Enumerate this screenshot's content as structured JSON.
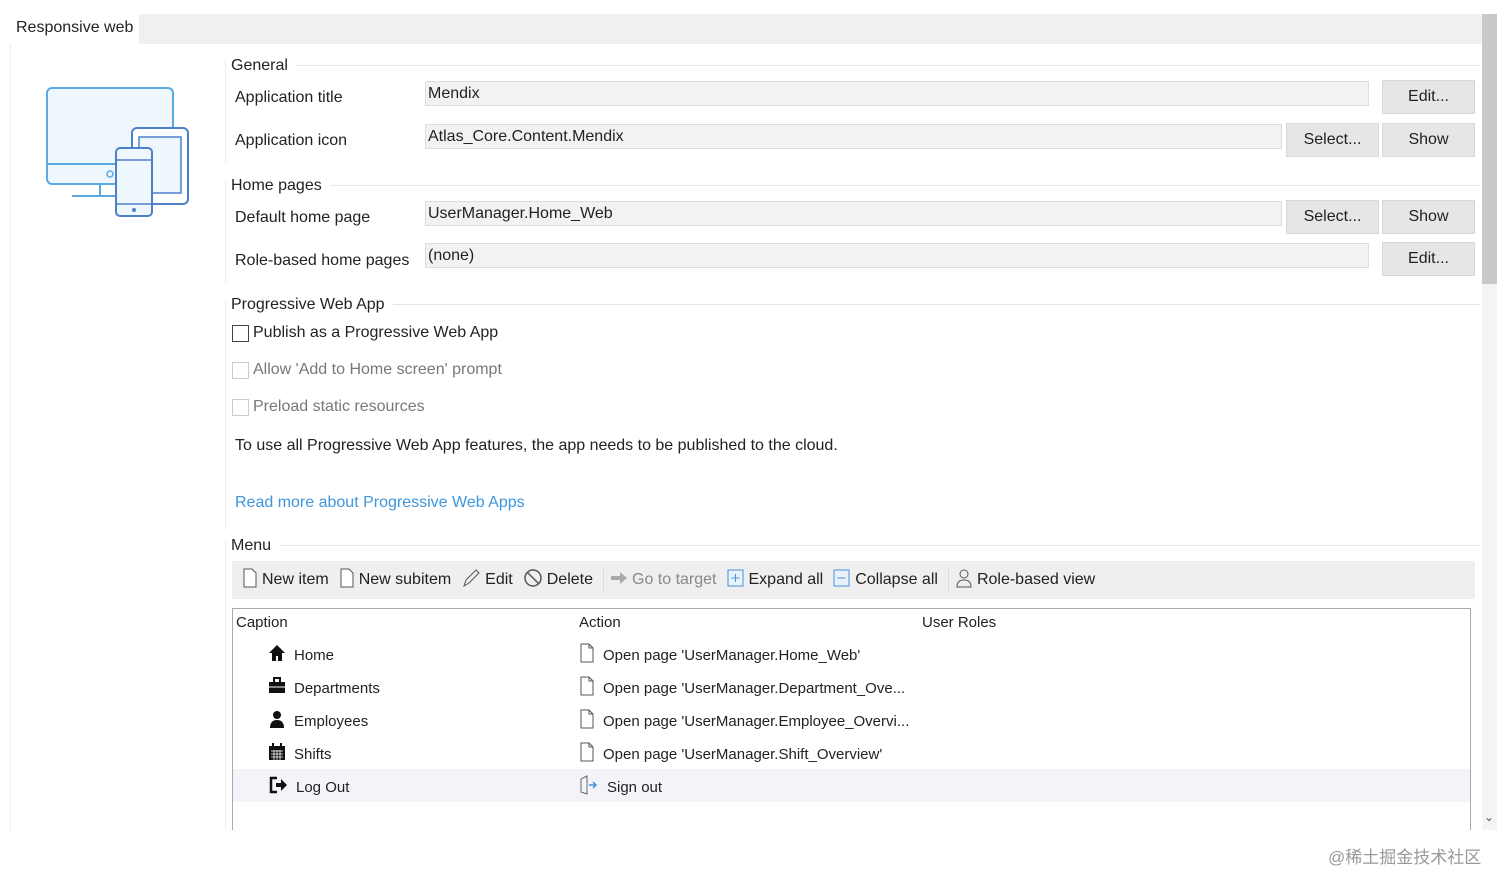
{
  "tab": {
    "label": "Responsive web"
  },
  "general": {
    "title": "General",
    "app_title_label": "Application title",
    "app_title_value": "Mendix",
    "app_icon_label": "Application icon",
    "app_icon_value": "Atlas_Core.Content.Mendix",
    "edit_label": "Edit...",
    "select_label": "Select...",
    "show_label": "Show"
  },
  "home": {
    "title": "Home pages",
    "default_label": "Default home page",
    "default_value": "UserManager.Home_Web",
    "role_label": "Role-based home pages",
    "role_value": "(none)",
    "select_label": "Select...",
    "show_label": "Show",
    "edit_label": "Edit..."
  },
  "pwa": {
    "title": "Progressive Web App",
    "publish": "Publish as a Progressive Web App",
    "publish_checked": false,
    "prompt": "Allow 'Add to Home screen' prompt",
    "preload": "Preload static resources",
    "info": "To use all Progressive Web App features, the app needs to be published to the cloud.",
    "link": "Read more about Progressive Web Apps"
  },
  "menu": {
    "title": "Menu",
    "toolbar": {
      "new_item": "New item",
      "new_subitem": "New subitem",
      "edit": "Edit",
      "delete": "Delete",
      "go_to_target": "Go to target",
      "expand_all": "Expand all",
      "collapse_all": "Collapse all",
      "role_view": "Role-based view"
    },
    "columns": [
      "Caption",
      "Action",
      "User Roles"
    ],
    "rows": [
      {
        "caption": "Home",
        "icon": "home-icon",
        "action": "Open page 'UserManager.Home_Web'"
      },
      {
        "caption": "Departments",
        "icon": "briefcase-icon",
        "action": "Open  page 'UserManager.Department_Ove..."
      },
      {
        "caption": "Employees",
        "icon": "user-icon",
        "action": "Open  page 'UserManager.Employee_Overvi..."
      },
      {
        "caption": "Shifts",
        "icon": "calendar-icon",
        "action": "Open page 'UserManager.Shift_Overview'"
      },
      {
        "caption": "Log Out",
        "icon": "logout-icon",
        "action": "Sign out"
      }
    ]
  },
  "watermark": "@稀土掘金技术社区"
}
